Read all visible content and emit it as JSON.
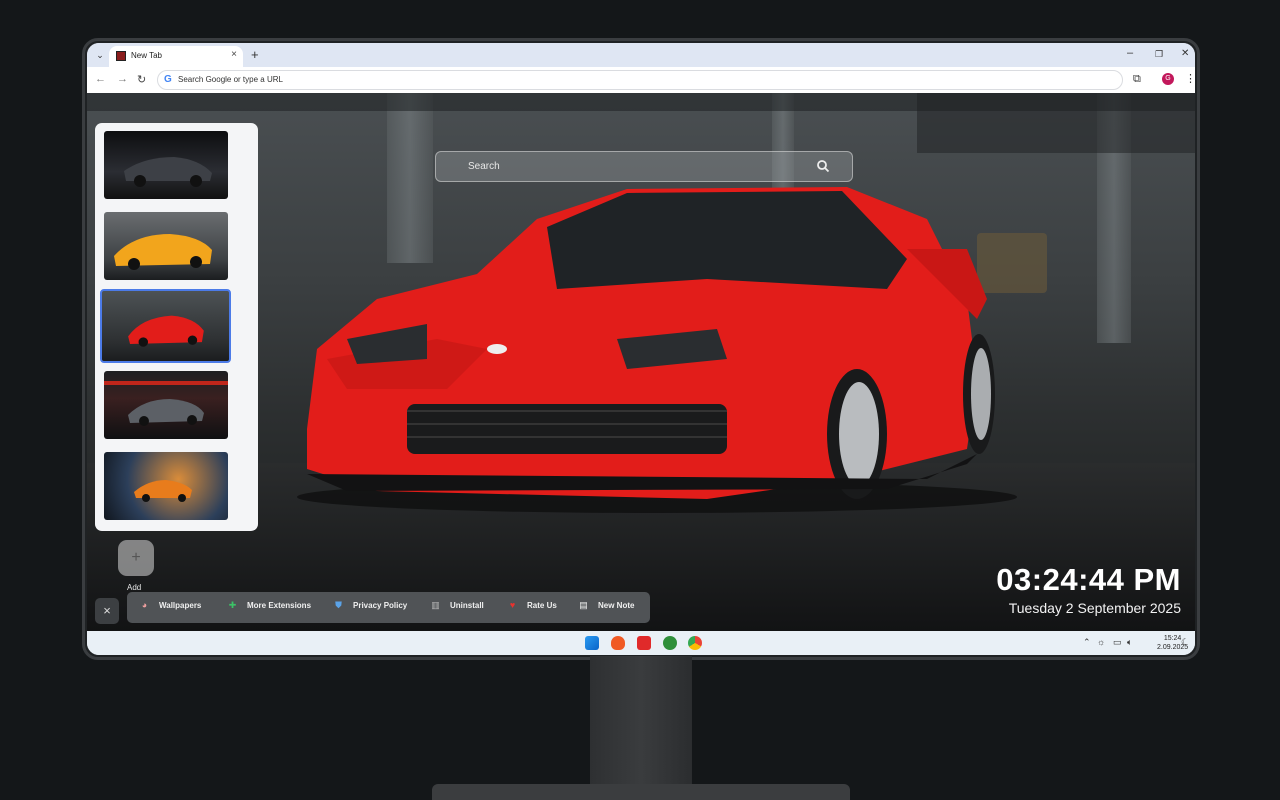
{
  "browser": {
    "tab_title": "New Tab",
    "tab_close": "×",
    "new_tab": "+",
    "omnibox_placeholder": "Search Google or type a URL",
    "profile_initial": "G",
    "minimize": "–",
    "restore": "❐",
    "close": "✕"
  },
  "page": {
    "search_placeholder": "Search",
    "add_label": "Add",
    "add_symbol": "+",
    "close_symbol": "×",
    "menu": [
      {
        "label": "Wallpapers",
        "icon": "palette-icon"
      },
      {
        "label": "More Extensions",
        "icon": "puzzle-icon"
      },
      {
        "label": "Privacy Policy",
        "icon": "shield-icon"
      },
      {
        "label": "Uninstall",
        "icon": "trash-icon"
      },
      {
        "label": "Rate Us",
        "icon": "heart-icon"
      },
      {
        "label": "New Note",
        "icon": "note-icon"
      }
    ],
    "clock": "03:24:44 PM",
    "date": "Tuesday 2 September 2025",
    "thumbnails": [
      {
        "name": "dark-supra",
        "selected": false
      },
      {
        "name": "orange-supra",
        "selected": false
      },
      {
        "name": "red-supra",
        "selected": true
      },
      {
        "name": "night-car",
        "selected": false
      },
      {
        "name": "sunset-car",
        "selected": false
      }
    ]
  },
  "taskbar": {
    "time": "15:24",
    "date": "2.09.2025"
  },
  "colors": {
    "accent": "#4c7be8",
    "car_red": "#e4201e",
    "profile": "#c2185b"
  }
}
